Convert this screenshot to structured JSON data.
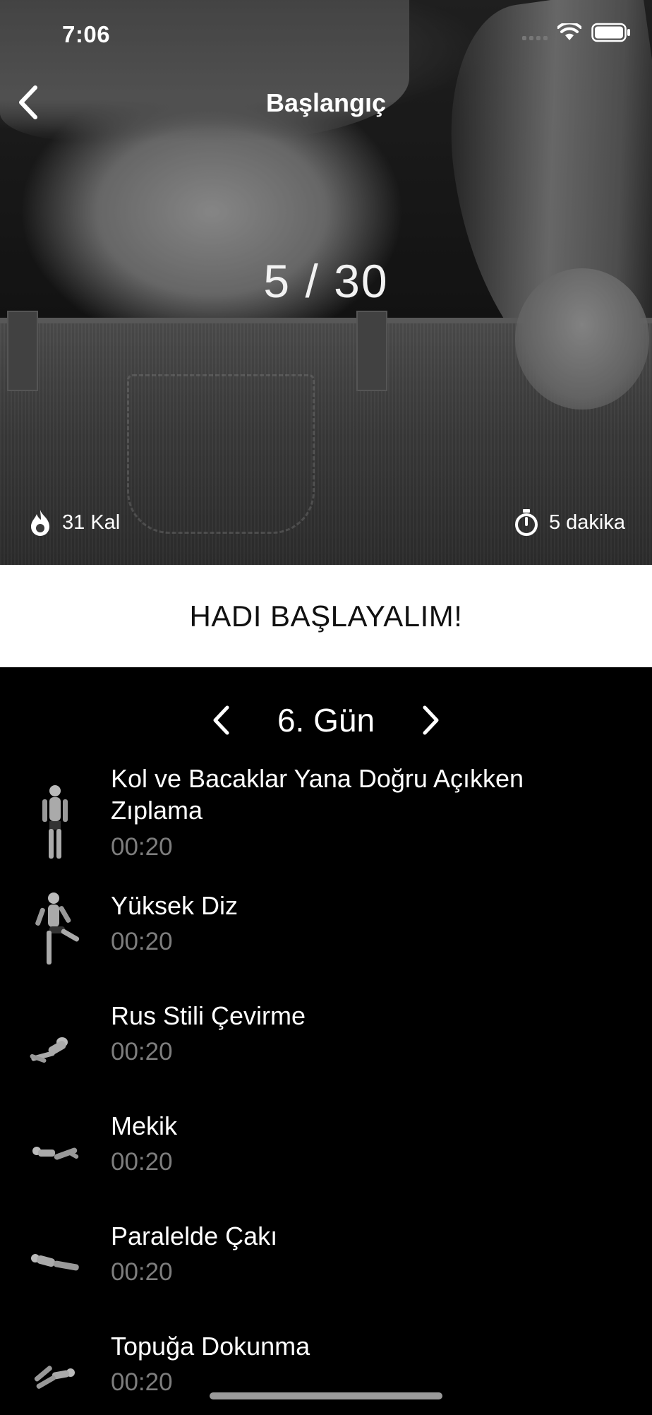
{
  "status_bar": {
    "time": "7:06"
  },
  "nav": {
    "title": "Başlangıç"
  },
  "hero": {
    "progress": "5 / 30",
    "calories": "31 Kal",
    "duration": "5 dakika"
  },
  "start_button": {
    "label": "HADI BAŞLAYALIM!"
  },
  "day_selector": {
    "label": "6. Gün"
  },
  "exercises": [
    {
      "name": "Kol ve Bacaklar Yana Doğru Açıkken Zıplama",
      "time": "00:20",
      "icon": "jumping-jack-figure"
    },
    {
      "name": "Yüksek Diz",
      "time": "00:20",
      "icon": "high-knees-figure"
    },
    {
      "name": "Rus Stili Çevirme",
      "time": "00:20",
      "icon": "russian-twist-figure"
    },
    {
      "name": "Mekik",
      "time": "00:20",
      "icon": "crunch-figure"
    },
    {
      "name": "Paralelde Çakı",
      "time": "00:20",
      "icon": "v-up-figure"
    },
    {
      "name": "Topuğa Dokunma",
      "time": "00:20",
      "icon": "heel-touch-figure"
    }
  ],
  "colors": {
    "background": "#000000",
    "button_bg": "#ffffff",
    "muted_text": "#7d7d7d"
  }
}
